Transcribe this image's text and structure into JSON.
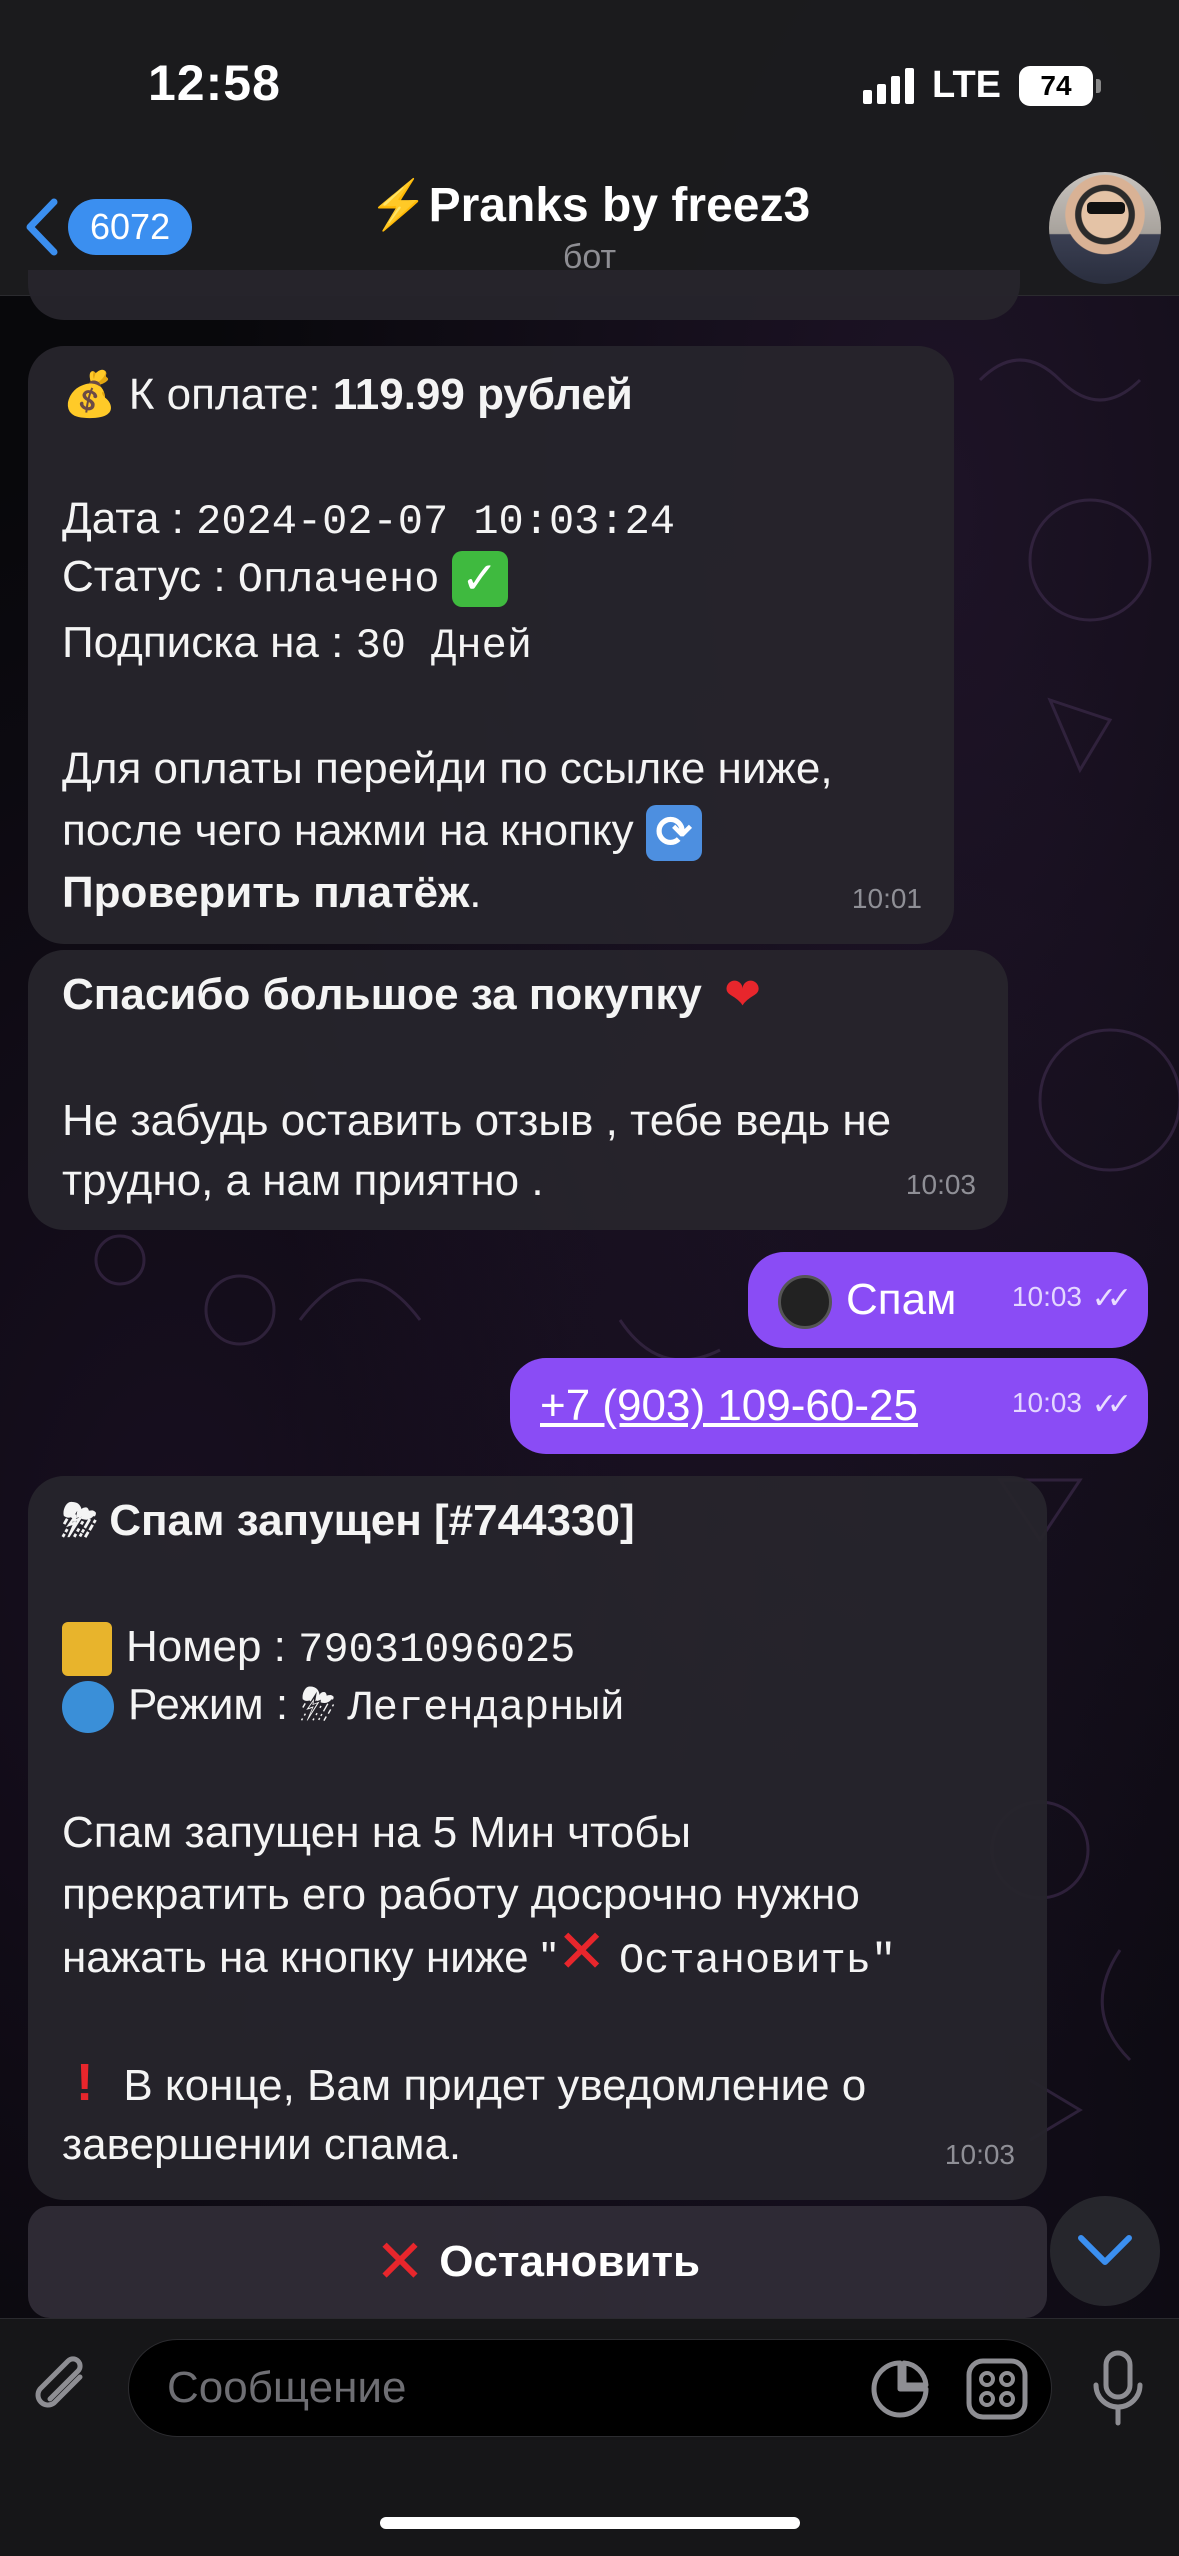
{
  "status_bar": {
    "time": "12:58",
    "network": "LTE",
    "battery": "74"
  },
  "header": {
    "back_count": "6072",
    "title": "⚡️Pranks by freez3",
    "subtitle": "бот"
  },
  "messages": [
    {
      "payment_prefix": "К оплате: ",
      "payment_amount": "119.99 рублей",
      "date_label": "Дата : ",
      "date_value": "2024-02-07 10:03:24",
      "status_label": "Статус : ",
      "status_value": "Оплачено",
      "sub_label": "Подписка на : ",
      "sub_value": "30 Дней",
      "instr_1": "Для оплаты перейди по ссылке ниже,",
      "instr_2": "после чего нажми на кнопку",
      "instr_3": "Проверить платёж",
      "instr_3_end": ".",
      "time": "10:01"
    },
    {
      "thanks": "Спасибо большое за покупку",
      "line_1": "Не забудь оставить отзыв , тебе ведь не",
      "line_2": "трудно, а нам приятно .",
      "time": "10:03"
    },
    {
      "text": "Спам",
      "time": "10:03"
    },
    {
      "text": "+7 (903) 109-60-25",
      "time": "10:03"
    },
    {
      "title": "Спам запущен [#744330]",
      "number_label": "Номер : ",
      "number_value": "79031096025",
      "mode_label": "Режим : ",
      "mode_value": "Легендарный",
      "body_1": "Спам запущен на 5 Мин чтобы",
      "body_2": "прекратить его работу досрочно нужно",
      "body_3_a": "нажать на кнопку ниже \"",
      "body_3_b": "Остановить\"",
      "note_1": "В конце, Вам придет уведомление о",
      "note_2": "завершении спама.",
      "time": "10:03"
    }
  ],
  "inline_button": {
    "label": "Остановить"
  },
  "composer": {
    "placeholder": "Сообщение"
  },
  "colors": {
    "accent": "#3b8ff0",
    "outgoing": "#8a4cf5",
    "incoming": "#26242c",
    "danger": "#e8262c"
  },
  "icons": [
    "back-chevron-icon",
    "attach-icon",
    "sticker-icon",
    "bot-commands-icon",
    "microphone-icon",
    "chevron-down-icon",
    "double-check-icon"
  ]
}
